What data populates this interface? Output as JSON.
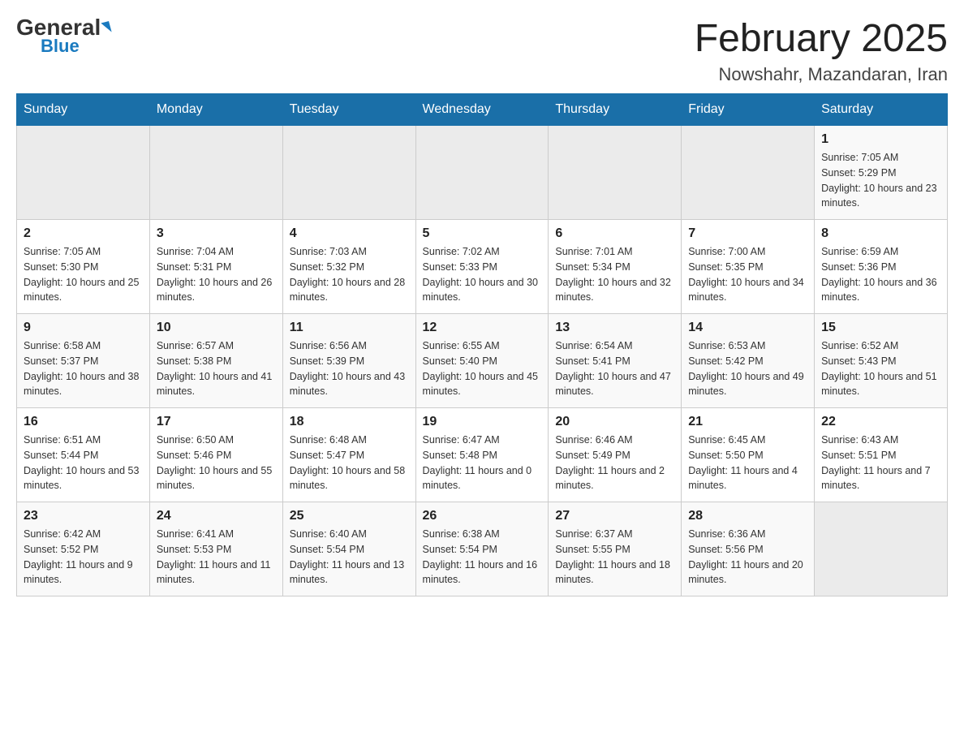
{
  "header": {
    "logo_general": "General",
    "logo_blue": "Blue",
    "title": "February 2025",
    "subtitle": "Nowshahr, Mazandaran, Iran"
  },
  "days_of_week": [
    "Sunday",
    "Monday",
    "Tuesday",
    "Wednesday",
    "Thursday",
    "Friday",
    "Saturday"
  ],
  "weeks": [
    {
      "days": [
        {
          "empty": true
        },
        {
          "empty": true
        },
        {
          "empty": true
        },
        {
          "empty": true
        },
        {
          "empty": true
        },
        {
          "empty": true
        },
        {
          "number": "1",
          "sunrise": "Sunrise: 7:05 AM",
          "sunset": "Sunset: 5:29 PM",
          "daylight": "Daylight: 10 hours and 23 minutes."
        }
      ]
    },
    {
      "days": [
        {
          "number": "2",
          "sunrise": "Sunrise: 7:05 AM",
          "sunset": "Sunset: 5:30 PM",
          "daylight": "Daylight: 10 hours and 25 minutes."
        },
        {
          "number": "3",
          "sunrise": "Sunrise: 7:04 AM",
          "sunset": "Sunset: 5:31 PM",
          "daylight": "Daylight: 10 hours and 26 minutes."
        },
        {
          "number": "4",
          "sunrise": "Sunrise: 7:03 AM",
          "sunset": "Sunset: 5:32 PM",
          "daylight": "Daylight: 10 hours and 28 minutes."
        },
        {
          "number": "5",
          "sunrise": "Sunrise: 7:02 AM",
          "sunset": "Sunset: 5:33 PM",
          "daylight": "Daylight: 10 hours and 30 minutes."
        },
        {
          "number": "6",
          "sunrise": "Sunrise: 7:01 AM",
          "sunset": "Sunset: 5:34 PM",
          "daylight": "Daylight: 10 hours and 32 minutes."
        },
        {
          "number": "7",
          "sunrise": "Sunrise: 7:00 AM",
          "sunset": "Sunset: 5:35 PM",
          "daylight": "Daylight: 10 hours and 34 minutes."
        },
        {
          "number": "8",
          "sunrise": "Sunrise: 6:59 AM",
          "sunset": "Sunset: 5:36 PM",
          "daylight": "Daylight: 10 hours and 36 minutes."
        }
      ]
    },
    {
      "days": [
        {
          "number": "9",
          "sunrise": "Sunrise: 6:58 AM",
          "sunset": "Sunset: 5:37 PM",
          "daylight": "Daylight: 10 hours and 38 minutes."
        },
        {
          "number": "10",
          "sunrise": "Sunrise: 6:57 AM",
          "sunset": "Sunset: 5:38 PM",
          "daylight": "Daylight: 10 hours and 41 minutes."
        },
        {
          "number": "11",
          "sunrise": "Sunrise: 6:56 AM",
          "sunset": "Sunset: 5:39 PM",
          "daylight": "Daylight: 10 hours and 43 minutes."
        },
        {
          "number": "12",
          "sunrise": "Sunrise: 6:55 AM",
          "sunset": "Sunset: 5:40 PM",
          "daylight": "Daylight: 10 hours and 45 minutes."
        },
        {
          "number": "13",
          "sunrise": "Sunrise: 6:54 AM",
          "sunset": "Sunset: 5:41 PM",
          "daylight": "Daylight: 10 hours and 47 minutes."
        },
        {
          "number": "14",
          "sunrise": "Sunrise: 6:53 AM",
          "sunset": "Sunset: 5:42 PM",
          "daylight": "Daylight: 10 hours and 49 minutes."
        },
        {
          "number": "15",
          "sunrise": "Sunrise: 6:52 AM",
          "sunset": "Sunset: 5:43 PM",
          "daylight": "Daylight: 10 hours and 51 minutes."
        }
      ]
    },
    {
      "days": [
        {
          "number": "16",
          "sunrise": "Sunrise: 6:51 AM",
          "sunset": "Sunset: 5:44 PM",
          "daylight": "Daylight: 10 hours and 53 minutes."
        },
        {
          "number": "17",
          "sunrise": "Sunrise: 6:50 AM",
          "sunset": "Sunset: 5:46 PM",
          "daylight": "Daylight: 10 hours and 55 minutes."
        },
        {
          "number": "18",
          "sunrise": "Sunrise: 6:48 AM",
          "sunset": "Sunset: 5:47 PM",
          "daylight": "Daylight: 10 hours and 58 minutes."
        },
        {
          "number": "19",
          "sunrise": "Sunrise: 6:47 AM",
          "sunset": "Sunset: 5:48 PM",
          "daylight": "Daylight: 11 hours and 0 minutes."
        },
        {
          "number": "20",
          "sunrise": "Sunrise: 6:46 AM",
          "sunset": "Sunset: 5:49 PM",
          "daylight": "Daylight: 11 hours and 2 minutes."
        },
        {
          "number": "21",
          "sunrise": "Sunrise: 6:45 AM",
          "sunset": "Sunset: 5:50 PM",
          "daylight": "Daylight: 11 hours and 4 minutes."
        },
        {
          "number": "22",
          "sunrise": "Sunrise: 6:43 AM",
          "sunset": "Sunset: 5:51 PM",
          "daylight": "Daylight: 11 hours and 7 minutes."
        }
      ]
    },
    {
      "days": [
        {
          "number": "23",
          "sunrise": "Sunrise: 6:42 AM",
          "sunset": "Sunset: 5:52 PM",
          "daylight": "Daylight: 11 hours and 9 minutes."
        },
        {
          "number": "24",
          "sunrise": "Sunrise: 6:41 AM",
          "sunset": "Sunset: 5:53 PM",
          "daylight": "Daylight: 11 hours and 11 minutes."
        },
        {
          "number": "25",
          "sunrise": "Sunrise: 6:40 AM",
          "sunset": "Sunset: 5:54 PM",
          "daylight": "Daylight: 11 hours and 13 minutes."
        },
        {
          "number": "26",
          "sunrise": "Sunrise: 6:38 AM",
          "sunset": "Sunset: 5:54 PM",
          "daylight": "Daylight: 11 hours and 16 minutes."
        },
        {
          "number": "27",
          "sunrise": "Sunrise: 6:37 AM",
          "sunset": "Sunset: 5:55 PM",
          "daylight": "Daylight: 11 hours and 18 minutes."
        },
        {
          "number": "28",
          "sunrise": "Sunrise: 6:36 AM",
          "sunset": "Sunset: 5:56 PM",
          "daylight": "Daylight: 11 hours and 20 minutes."
        },
        {
          "empty": true
        }
      ]
    }
  ]
}
